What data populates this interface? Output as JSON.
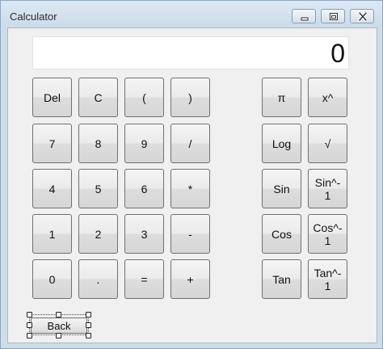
{
  "window": {
    "title": "Calculator"
  },
  "display": {
    "value": "0"
  },
  "keypad_left": [
    [
      "Del",
      "C",
      "(",
      ")"
    ],
    [
      "7",
      "8",
      "9",
      "/"
    ],
    [
      "4",
      "5",
      "6",
      "*"
    ],
    [
      "1",
      "2",
      "3",
      "-"
    ],
    [
      "0",
      ".",
      "=",
      "+"
    ]
  ],
  "keypad_right": [
    [
      "π",
      "x^"
    ],
    [
      "Log",
      "√"
    ],
    [
      "Sin",
      "Sin^-\n1"
    ],
    [
      "Cos",
      "Cos^-\n1"
    ],
    [
      "Tan",
      "Tan^-\n1"
    ]
  ],
  "back_button": {
    "label": "Back"
  }
}
